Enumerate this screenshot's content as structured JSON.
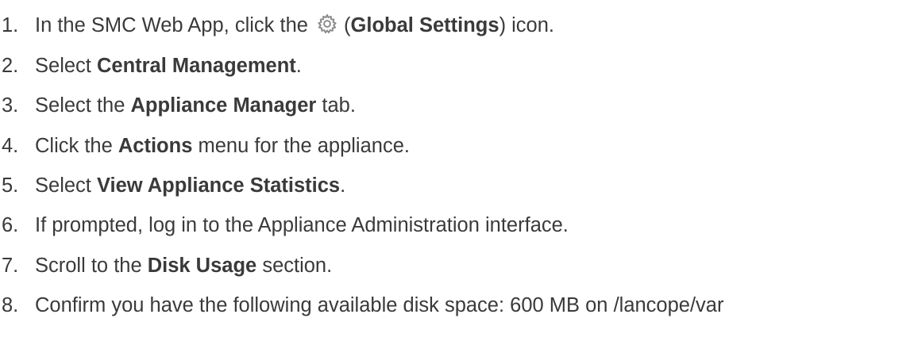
{
  "steps": [
    {
      "number": "1.",
      "parts": [
        {
          "t": "In the SMC Web App, click the "
        },
        {
          "icon": "gear-icon"
        },
        {
          "t": "("
        },
        {
          "b": "Global Settings"
        },
        {
          "t": ") icon."
        }
      ]
    },
    {
      "number": "2.",
      "parts": [
        {
          "t": "Select "
        },
        {
          "b": "Central Management"
        },
        {
          "t": "."
        }
      ]
    },
    {
      "number": "3.",
      "parts": [
        {
          "t": "Select the "
        },
        {
          "b": "Appliance Manager"
        },
        {
          "t": " tab."
        }
      ]
    },
    {
      "number": "4.",
      "parts": [
        {
          "t": "Click the "
        },
        {
          "b": "Actions"
        },
        {
          "t": " menu for the appliance."
        }
      ]
    },
    {
      "number": "5.",
      "parts": [
        {
          "t": "Select "
        },
        {
          "b": "View Appliance Statistics"
        },
        {
          "t": "."
        }
      ]
    },
    {
      "number": "6.",
      "parts": [
        {
          "t": "If prompted, log in to the Appliance Administration interface."
        }
      ]
    },
    {
      "number": "7.",
      "parts": [
        {
          "t": "Scroll to the "
        },
        {
          "b": "Disk Usage"
        },
        {
          "t": " section."
        }
      ]
    },
    {
      "number": "8.",
      "parts": [
        {
          "t": "Confirm you have the following available disk space: 600 MB on /lancope/var"
        }
      ]
    }
  ],
  "icon_color": "#8a8a8a",
  "text_color": "#3a3a3a"
}
